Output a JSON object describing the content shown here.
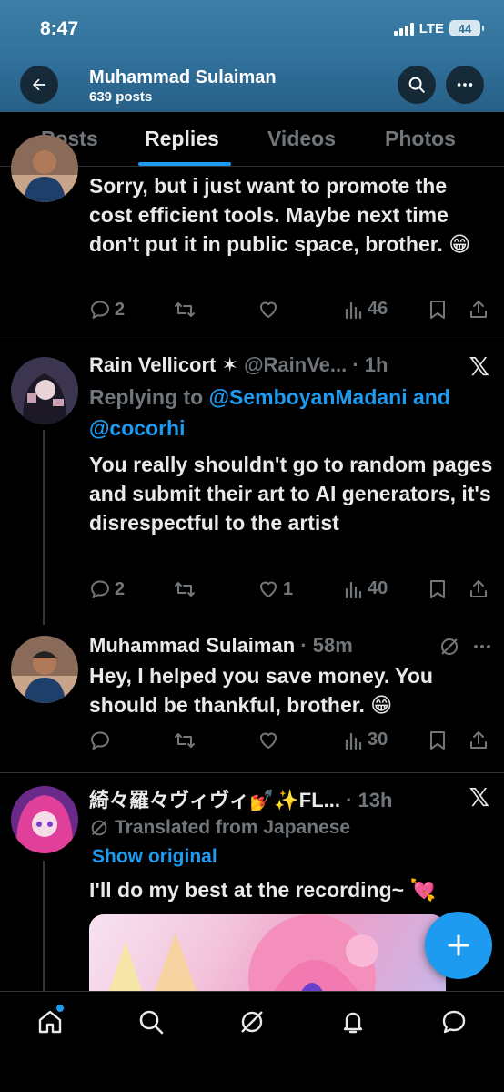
{
  "status_bar": {
    "time": "8:47",
    "network": "LTE",
    "battery": "44"
  },
  "profile": {
    "name": "Muhammad Sulaiman",
    "posts_count": "639 posts"
  },
  "tabs": [
    {
      "label": "Posts",
      "active": false
    },
    {
      "label": "Replies",
      "active": true
    },
    {
      "label": "Videos",
      "active": false
    },
    {
      "label": "Photos",
      "active": false
    }
  ],
  "tweets": [
    {
      "body": "Sorry, but i just want to promote the cost efficient tools. Maybe next time don't put it in public space, brother. 😁",
      "replies": "2",
      "reposts": "",
      "likes": "",
      "views": "46"
    },
    {
      "author": "Rain Vellicort ✶",
      "handle": "@RainVe...",
      "time": "· 1h",
      "replying_prefix": "Replying to ",
      "replying_users": "@SemboyanMadani and @cocorhi",
      "body": "You really shouldn't go to random pages and submit their art to AI generators, it's disrespectful to the artist",
      "replies": "2",
      "reposts": "",
      "likes": "1",
      "views": "40"
    },
    {
      "author": "Muhammad Sulaiman",
      "time": "· 58m",
      "body": "Hey, I helped you save money. You should be thankful, brother. 😁",
      "replies": "",
      "reposts": "",
      "likes": "",
      "views": "30"
    },
    {
      "author": "綺々羅々ヴィヴィ💅✨FL...",
      "time": "· 13h",
      "translated_label": "Translated from Japanese",
      "show_original": "Show original",
      "body": "I'll do my best at the recording~ 💘"
    }
  ],
  "icons": {
    "back": "back-arrow-icon",
    "search": "search-icon",
    "more": "more-icon",
    "reply": "reply-icon",
    "repost": "repost-icon",
    "like": "like-icon",
    "views": "views-icon",
    "bookmark": "bookmark-icon",
    "share": "share-icon",
    "compose": "compose-icon"
  },
  "colors": {
    "accent": "#1d9bf0",
    "header_bg": "#2f6e98",
    "muted": "#71767b",
    "text": "#e7e9ea"
  }
}
